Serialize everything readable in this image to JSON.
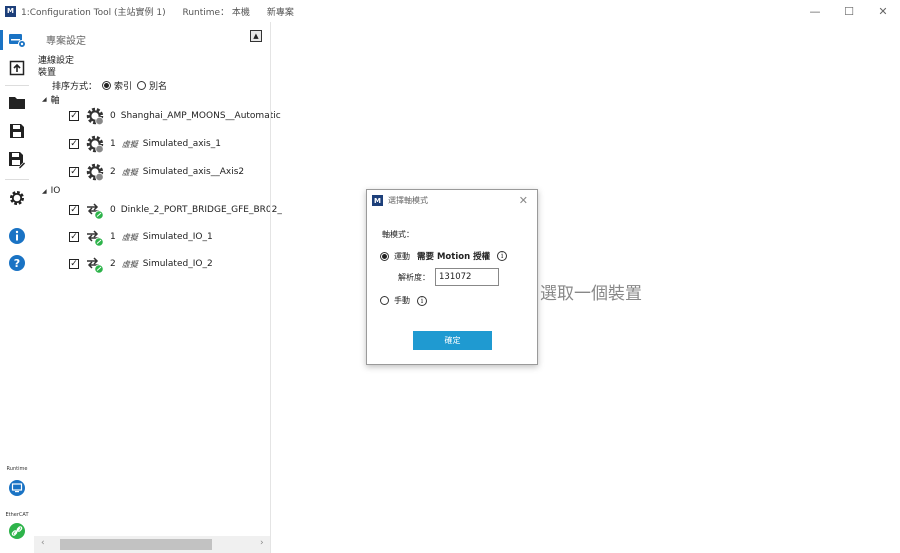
{
  "window": {
    "title": "1:Configuration Tool (主站實例 1)",
    "runtime_label": "Runtime： 本機",
    "project_label": "新專案",
    "minimize": "—",
    "maximize": "☐",
    "close": "✕"
  },
  "toolbar": {
    "runtime_label": "Runtime",
    "ethercat_label": "EtherCAT"
  },
  "panel": {
    "header": "專案設定",
    "connection": "連線設定",
    "device": "裝置",
    "sort_label": "排序方式：",
    "sort_options": [
      "索引",
      "別名"
    ],
    "sort_selected": "索引",
    "axis_group": "軸",
    "io_group": "IO",
    "axes": [
      {
        "index": "0",
        "simulated": "",
        "name": "Shanghai_AMP_MOONS__Automatic"
      },
      {
        "index": "1",
        "simulated": "虛擬",
        "name": "Simulated_axis_1"
      },
      {
        "index": "2",
        "simulated": "虛擬",
        "name": "Simulated_axis__Axis2"
      }
    ],
    "ios": [
      {
        "index": "0",
        "simulated": "",
        "name": "Dinkle_2_PORT_BRIDGE_GFE_BR02_"
      },
      {
        "index": "1",
        "simulated": "虛擬",
        "name": "Simulated_IO_1"
      },
      {
        "index": "2",
        "simulated": "虛擬",
        "name": "Simulated_IO_2"
      }
    ]
  },
  "main": {
    "empty_message": "選取一個裝置"
  },
  "dialog": {
    "title": "選擇軸模式",
    "axis_mode_label": "軸模式：",
    "motion_option": "運動",
    "motion_note": "需要 Motion 授權",
    "resolution_label": "解析度：",
    "resolution_value": "131072",
    "manual_option": "手動",
    "selected_mode": "運動",
    "ok_button": "確定",
    "info_glyph": "i"
  },
  "colors": {
    "accent": "#1f9ad1",
    "toolbar_blue": "#1a73c4",
    "status_green": "#2db34a",
    "logo": "#1d3f7a"
  }
}
